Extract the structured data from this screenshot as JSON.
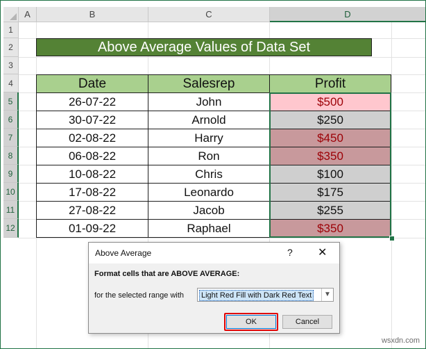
{
  "columns": [
    "A",
    "B",
    "C",
    "D"
  ],
  "rows": [
    "1",
    "2",
    "3",
    "4",
    "5",
    "6",
    "7",
    "8",
    "9",
    "10",
    "11",
    "12"
  ],
  "banner": "Above Average Values of Data Set",
  "table": {
    "headers": [
      "Date",
      "Salesrep",
      "Profit"
    ],
    "rows": [
      {
        "date": "26-07-22",
        "salesrep": "John",
        "profit": "$500",
        "style": "light-red"
      },
      {
        "date": "30-07-22",
        "salesrep": "Arnold",
        "profit": "$250",
        "style": "gray"
      },
      {
        "date": "02-08-22",
        "salesrep": "Harry",
        "profit": "$450",
        "style": "dark-red"
      },
      {
        "date": "06-08-22",
        "salesrep": "Ron",
        "profit": "$350",
        "style": "dark-red"
      },
      {
        "date": "10-08-22",
        "salesrep": "Chris",
        "profit": "$100",
        "style": "gray"
      },
      {
        "date": "17-08-22",
        "salesrep": "Leonardo",
        "profit": "$175",
        "style": "gray"
      },
      {
        "date": "27-08-22",
        "salesrep": "Jacob",
        "profit": "$255",
        "style": "gray"
      },
      {
        "date": "01-09-22",
        "salesrep": "Raphael",
        "profit": "$350",
        "style": "dark-red"
      }
    ]
  },
  "dialog": {
    "title": "Above Average",
    "help": "?",
    "close": "✕",
    "heading": "Format cells that are ABOVE AVERAGE:",
    "range_label": "for the selected range with",
    "format_value": "Light Red Fill with Dark Red Text",
    "ok": "OK",
    "cancel": "Cancel"
  },
  "watermark": "wsxdn.com",
  "colors": {
    "accent": "#217346",
    "banner": "#548235",
    "header_fill": "#a9d08e",
    "light_red": "#ffc7ce",
    "dark_red_text": "#9c0006",
    "highlight": "#e00000"
  }
}
